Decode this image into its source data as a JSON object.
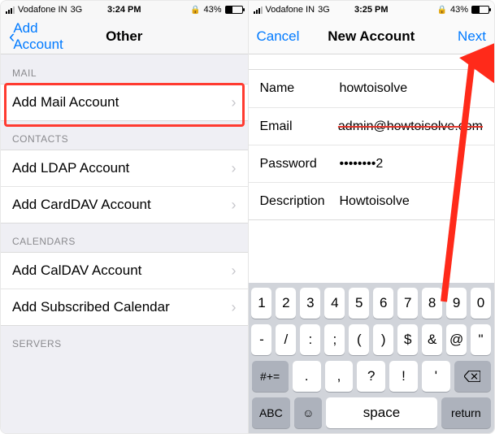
{
  "left": {
    "status": {
      "carrier": "Vodafone IN",
      "net": "3G",
      "time": "3:24 PM",
      "battery": "43%"
    },
    "nav": {
      "back": "Add Account",
      "title": "Other"
    },
    "sections": {
      "mail": {
        "header": "MAIL",
        "items": [
          "Add Mail Account"
        ]
      },
      "contacts": {
        "header": "CONTACTS",
        "items": [
          "Add LDAP Account",
          "Add CardDAV Account"
        ]
      },
      "calendars": {
        "header": "CALENDARS",
        "items": [
          "Add CalDAV Account",
          "Add Subscribed Calendar"
        ]
      },
      "servers": {
        "header": "SERVERS"
      }
    }
  },
  "right": {
    "status": {
      "carrier": "Vodafone IN",
      "net": "3G",
      "time": "3:25 PM",
      "battery": "43%"
    },
    "nav": {
      "cancel": "Cancel",
      "title": "New Account",
      "next": "Next"
    },
    "form": {
      "name": {
        "label": "Name",
        "value": "howtoisolve"
      },
      "email": {
        "label": "Email",
        "value": "admin@howtoisolve.com"
      },
      "password": {
        "label": "Password",
        "value": "••••••••2"
      },
      "description": {
        "label": "Description",
        "value": "Howtoisolve"
      }
    },
    "keyboard": {
      "row1": [
        "1",
        "2",
        "3",
        "4",
        "5",
        "6",
        "7",
        "8",
        "9",
        "0"
      ],
      "row2": [
        "-",
        "/",
        ":",
        ";",
        "(",
        ")",
        "$",
        "&",
        "@",
        "\""
      ],
      "row3_shift": "#+=",
      "row3": [
        ".",
        ",",
        "?",
        "!",
        "'"
      ],
      "row4": {
        "abc": "ABC",
        "space": "space",
        "return": "return"
      }
    }
  }
}
